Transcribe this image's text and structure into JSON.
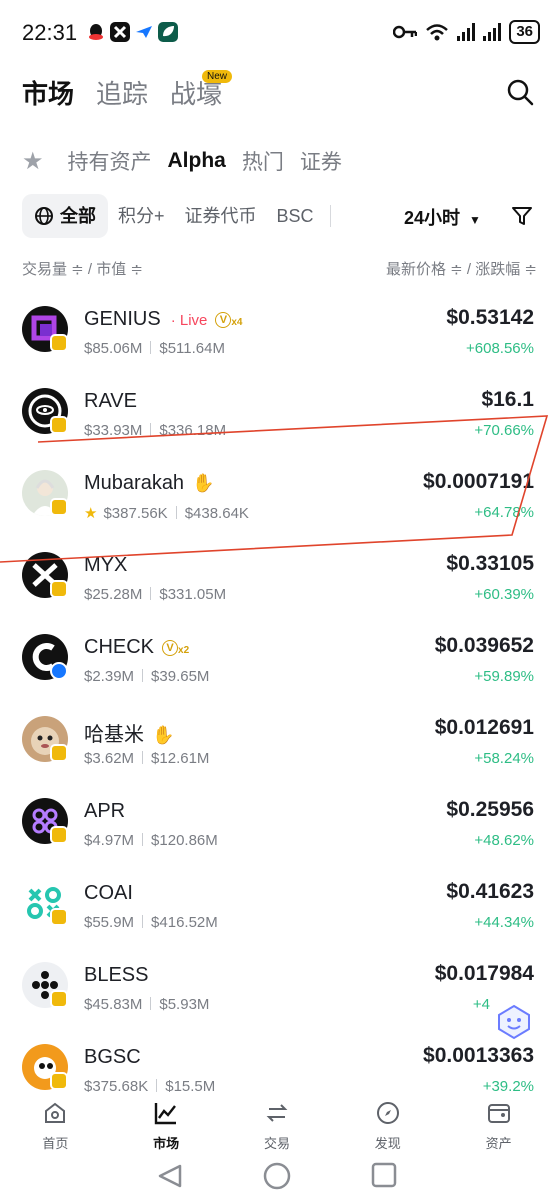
{
  "status": {
    "time": "22:31",
    "battery": "36"
  },
  "top_tabs": [
    {
      "label": "市场",
      "active": true
    },
    {
      "label": "追踪",
      "active": false
    },
    {
      "label": "战壕",
      "active": false
    }
  ],
  "new_badge": "New",
  "sub_tabs": [
    {
      "label": "持有资产",
      "active": false
    },
    {
      "label": "Alpha",
      "active": true
    },
    {
      "label": "热门",
      "active": false
    },
    {
      "label": "证券",
      "active": false
    }
  ],
  "filters": {
    "all": "全部",
    "points": "积分+",
    "sec_token": "证券代币",
    "bsc": "BSC",
    "period": "24小时"
  },
  "columns": {
    "left": "交易量 ≑ / 市值 ≑",
    "right": "最新价格 ≑ / 涨跌幅 ≑"
  },
  "rows": [
    {
      "name": "GENIUS",
      "live": "· Live",
      "vtag": "x4",
      "volume": "$85.06M",
      "mcap": "$511.64M",
      "price": "$0.53142",
      "change": "+608.56%"
    },
    {
      "name": "RAVE",
      "volume": "$33.93M",
      "mcap": "$336.18M",
      "price": "$16.1",
      "change": "+70.66%"
    },
    {
      "name": "Mubarakah",
      "volume": "$387.56K",
      "mcap": "$438.64K",
      "price": "$0.0007191",
      "change": "+64.78%"
    },
    {
      "name": "MYX",
      "volume": "$25.28M",
      "mcap": "$331.05M",
      "price": "$0.33105",
      "change": "+60.39%"
    },
    {
      "name": "CHECK",
      "vtag": "x2",
      "volume": "$2.39M",
      "mcap": "$39.65M",
      "price": "$0.039652",
      "change": "+59.89%"
    },
    {
      "name": "哈基米",
      "volume": "$3.62M",
      "mcap": "$12.61M",
      "price": "$0.012691",
      "change": "+58.24%"
    },
    {
      "name": "APR",
      "volume": "$4.97M",
      "mcap": "$120.86M",
      "price": "$0.25956",
      "change": "+48.62%"
    },
    {
      "name": "COAI",
      "volume": "$55.9M",
      "mcap": "$416.52M",
      "price": "$0.41623",
      "change": "+44.34%"
    },
    {
      "name": "BLESS",
      "volume": "$45.83M",
      "mcap": "$5.93M",
      "price": "$0.017984",
      "change": "+4"
    },
    {
      "name": "BGSC",
      "volume": "$375.68K",
      "mcap": "$15.5M",
      "price": "$0.0013363",
      "change": "+39.2%"
    }
  ],
  "bottom_tabs": [
    {
      "label": "首页",
      "icon": "home-icon"
    },
    {
      "label": "市场",
      "icon": "chart-icon",
      "active": true
    },
    {
      "label": "交易",
      "icon": "exchange-icon"
    },
    {
      "label": "发现",
      "icon": "compass-icon"
    },
    {
      "label": "资产",
      "icon": "wallet-icon"
    }
  ],
  "colors": {
    "accent": "#f0b90b",
    "up": "#2ebd85",
    "live": "#f6465d",
    "annotation": "#e0442c"
  }
}
